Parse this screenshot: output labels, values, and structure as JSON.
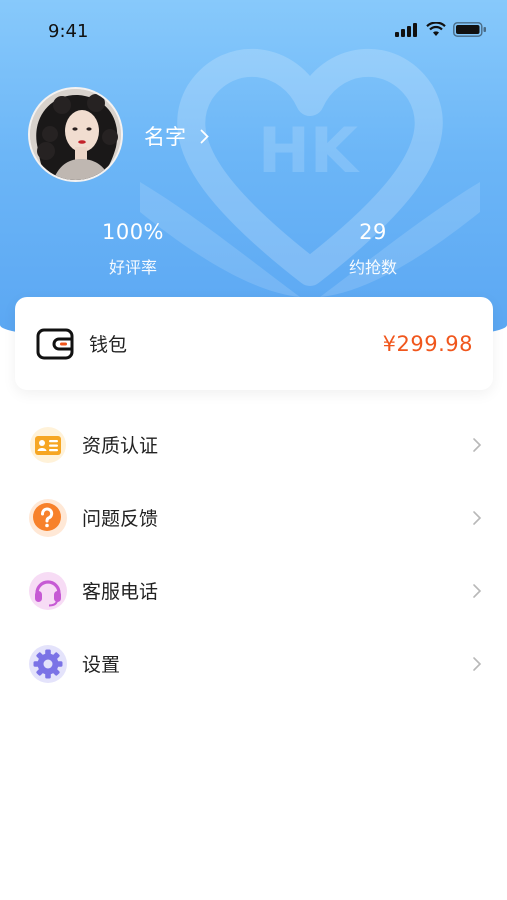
{
  "status_bar": {
    "time": "9:41"
  },
  "profile": {
    "name": "名字"
  },
  "stats": [
    {
      "value": "100%",
      "label": "好评率"
    },
    {
      "value": "29",
      "label": "约抢数"
    }
  ],
  "wallet": {
    "label": "钱包",
    "amount": "¥299.98"
  },
  "menu": {
    "items": [
      {
        "label": "资质认证",
        "icon": "id-card-icon"
      },
      {
        "label": "问题反馈",
        "icon": "question-icon"
      },
      {
        "label": "客服电话",
        "icon": "headset-icon"
      },
      {
        "label": "设置",
        "icon": "gear-icon"
      }
    ]
  },
  "colors": {
    "header_top": "#87c9fb",
    "header_bottom": "#5aa6f2",
    "amount": "#f0561c"
  }
}
